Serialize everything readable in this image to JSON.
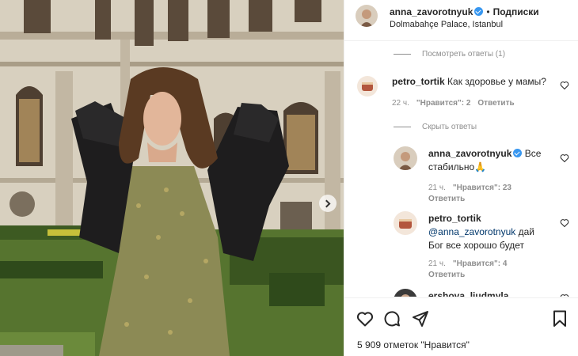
{
  "header": {
    "username": "anna_zavorotnyuk",
    "separator": "•",
    "follow_label": "Подписки",
    "location": "Dolmabahçe Palace, Istanbul"
  },
  "comments": {
    "view_replies": "Посмотреть ответы (1)",
    "hide_replies": "Скрыть ответы",
    "items": [
      {
        "username": "petro_tortik",
        "text": "Как здоровье у мамы?",
        "time": "22 ч.",
        "likes": "\"Нравится\": 2",
        "reply": "Ответить"
      },
      {
        "username": "anna_zavorotnyuk",
        "text_line1": "Все",
        "text_line2": "стабильно🙏",
        "time": "21 ч.",
        "likes": "\"Нравится\": 23",
        "reply": "Ответить"
      },
      {
        "username": "petro_tortik",
        "mention": "@anna_zavorotnyuk",
        "text_line1": " дай",
        "text_line2": "Бог все хорошо будет",
        "time": "21 ч.",
        "likes": "\"Нравится\": 4",
        "reply": "Ответить"
      },
      {
        "username": "ershova_liudmyla"
      }
    ]
  },
  "footer": {
    "likes_text": "5 909 отметок \"Нравится\""
  },
  "icons": [
    "heart-icon",
    "comment-icon",
    "share-icon",
    "bookmark-icon",
    "verified-badge-icon",
    "chevron-right-icon"
  ],
  "colors": {
    "verified": "#3897f0",
    "secondary_text": "#8e8e8e",
    "mention": "#00376b"
  }
}
